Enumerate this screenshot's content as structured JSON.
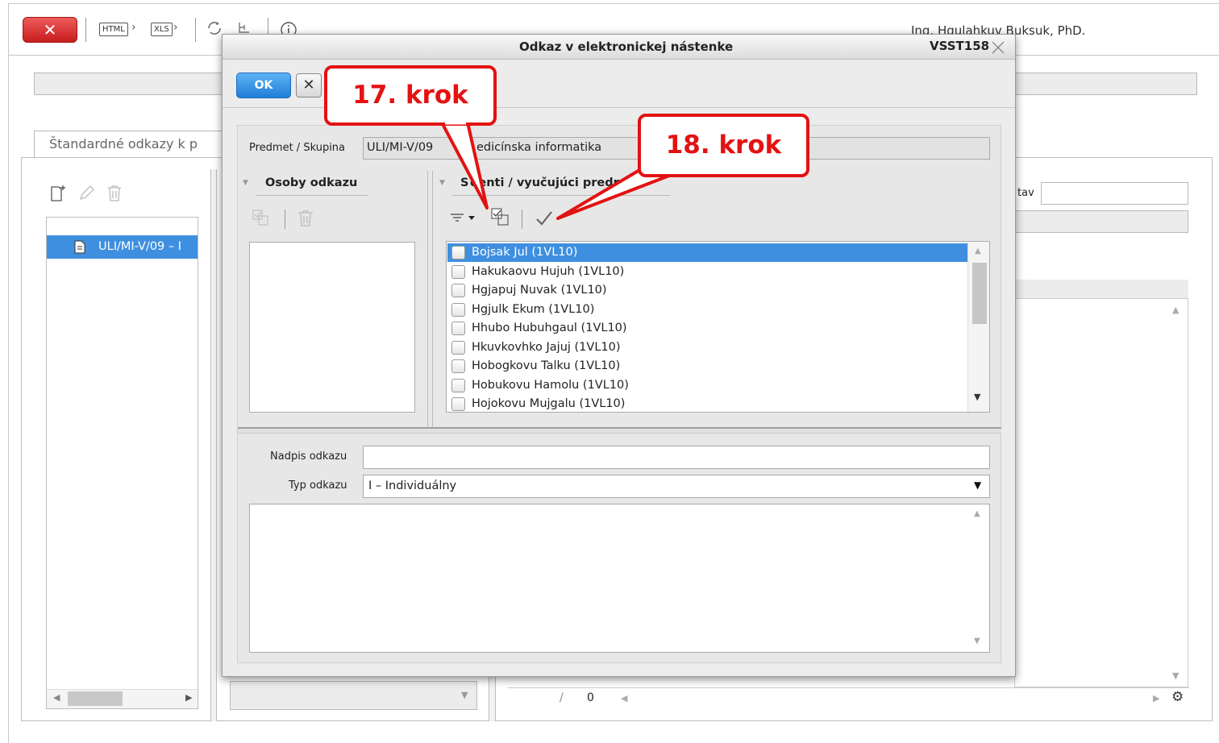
{
  "toolbar": {
    "close_label": "✕",
    "html_label": "HTML",
    "xls_label": "XLS",
    "user_name": "Ing. Hgulahkuv Buksuk, PhD."
  },
  "background": {
    "tab_label": "Štandardné odkazy k p",
    "tree_item": "ULI/MI-V/09 – I",
    "right_label": "tav",
    "pager_sep": "/",
    "pager_count": "0"
  },
  "dialog": {
    "title": "Odkaz v elektronickej nástenke",
    "code": "VSST158",
    "ok_label": "OK",
    "cancel_label": "✕",
    "subject_label": "Predmet / Skupina",
    "subject_value_left": "ULI/MI-V/09",
    "subject_value_right": "edicínska informatika",
    "persons_header": "Osoby odkazu",
    "students_header_left": "S",
    "students_header_right": "denti / vyučujúci predme",
    "students": [
      "Bojsak Jul (1VL10)",
      "Hakukaovu Hujuh (1VL10)",
      "Hgjapuj Nuvak (1VL10)",
      "Hgjulk Ekum (1VL10)",
      "Hhubo Hubuhgaul (1VL10)",
      "Hkuvkovhko Jajuj (1VL10)",
      "Hobogkovu Talku (1VL10)",
      "Hobukovu Hamolu (1VL10)",
      "Hojokovu Mujgalu (1VL10)"
    ],
    "selected_index": 0,
    "title_field_label": "Nadpis odkazu",
    "title_field_value": "",
    "type_label": "Typ odkazu",
    "type_value": "I – Individuálny"
  },
  "callouts": {
    "step17": "17. krok",
    "step18": "18. krok"
  },
  "colors": {
    "close_red": "#d62b2b",
    "ok_blue": "#2a8ae0",
    "selection_blue": "#3f8fe0",
    "callout_red": "#e31212"
  }
}
